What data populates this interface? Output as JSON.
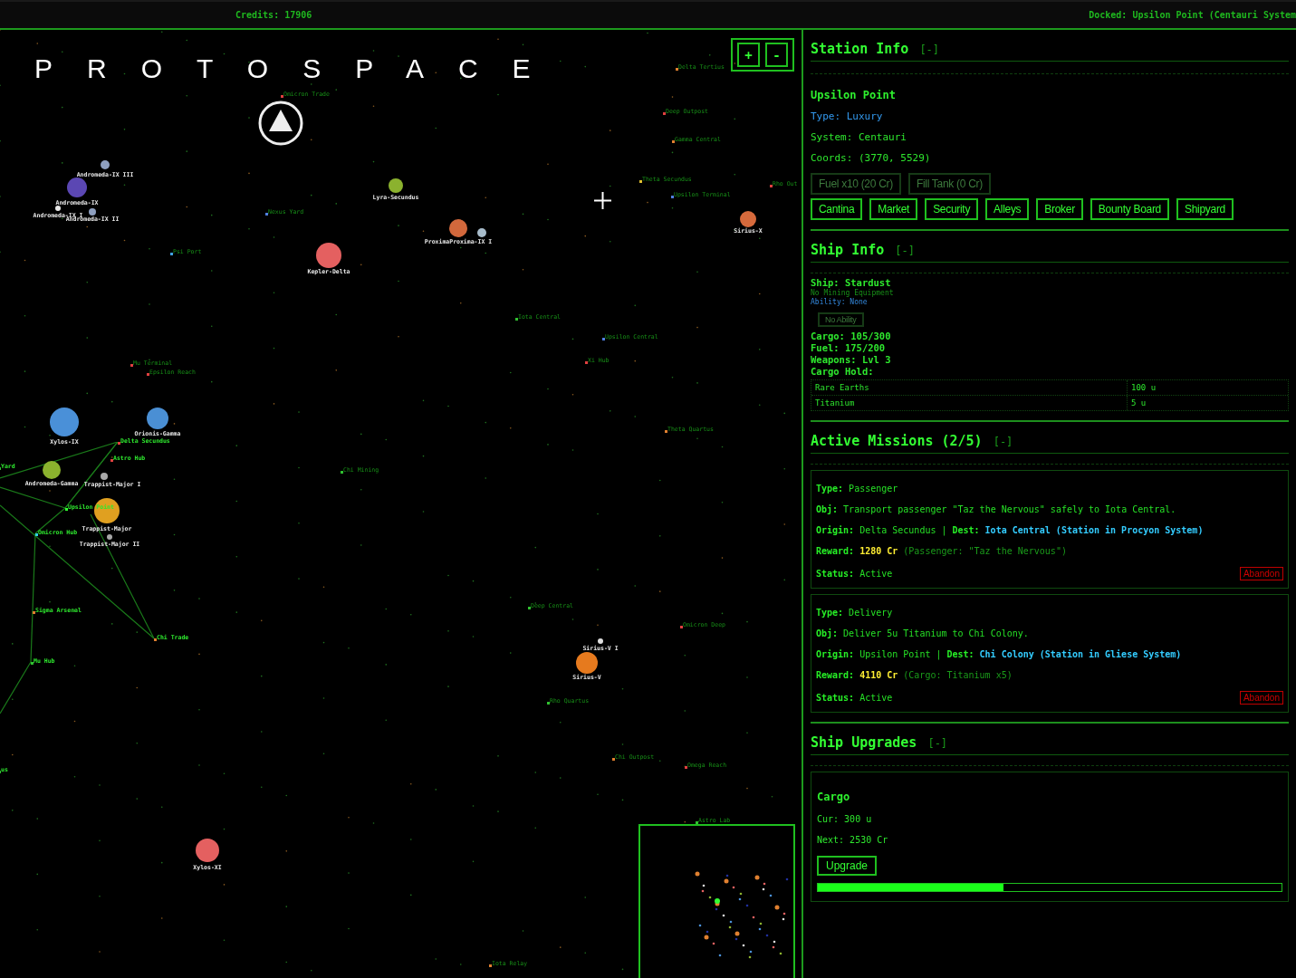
{
  "top_bar": {
    "credits": "Credits: 17906",
    "docked": "Docked: Upsilon Point (Centauri System"
  },
  "map": {
    "logo": "PROTOSPACE",
    "zoom_buttons": [
      "+",
      "-"
    ],
    "planets": [
      {
        "name": "Andromeda-IX III",
        "color": "#8e9fbf"
      },
      {
        "name": "Andromeda-IX",
        "color": "#5b47b3"
      },
      {
        "name": "Andromeda-IX I",
        "color": "#e8e8e8"
      },
      {
        "name": "Andromeda-IX II",
        "color": "#8e9fbf"
      },
      {
        "name": "Lyra-Secundus",
        "color": "#8bb22e"
      },
      {
        "name": "ProximaProxima-IX I",
        "color": "#d2683c"
      },
      {
        "color": "#a8bccb"
      },
      {
        "name": "Kepler-Delta",
        "color": "#e46060"
      },
      {
        "name": "Sirius-X",
        "color": "#d66a3c"
      },
      {
        "name": "Xylos-IX",
        "color": "#4a90d8"
      },
      {
        "name": "Orionis-Gamma",
        "color": "#4a8fd4"
      },
      {
        "name": "Andromeda-Gamma",
        "color": "#8bb22e"
      },
      {
        "name": "Trappist-Major I",
        "color": "#a8a8a8"
      },
      {
        "name": "Trappist-Major",
        "color": "#e0a020"
      },
      {
        "name": "Trappist-Major II",
        "color": "#a8a8a8"
      },
      {
        "name": "Sirius-V I",
        "color": "#dddddd"
      },
      {
        "name": "Sirius-V",
        "color": "#e67a1e"
      },
      {
        "name": "Xylos-XI",
        "color": "#e46060"
      }
    ],
    "stations": [
      {
        "name": "Delta Tertius",
        "color": "#e08030",
        "on_route": false
      },
      {
        "name": "Omicron Trade",
        "color": "#e04040",
        "on_route": false
      },
      {
        "name": "Deep Outpost",
        "color": "#e04040",
        "on_route": false
      },
      {
        "name": "Gamma Central",
        "color": "#e08030",
        "on_route": false
      },
      {
        "name": "Theta Secundus",
        "color": "#e0c030",
        "on_route": false
      },
      {
        "name": "Upsilon Terminal",
        "color": "#5080e0",
        "on_route": false
      },
      {
        "name": "Rho Out",
        "color": "#e04040",
        "on_route": false
      },
      {
        "name": "Nexus Yard",
        "color": "#5080e0",
        "on_route": false
      },
      {
        "name": "Psi Port",
        "color": "#40a0e0",
        "on_route": false
      },
      {
        "name": "Iota Central",
        "color": "#30c030",
        "on_route": false
      },
      {
        "name": "Upsilon Central",
        "color": "#5080e0",
        "on_route": false
      },
      {
        "name": "Xi Hub",
        "color": "#e04040",
        "on_route": false
      },
      {
        "name": "Mu Terminal",
        "color": "#e04040",
        "on_route": false
      },
      {
        "name": "Epsilon Reach",
        "color": "#e04040",
        "on_route": false
      },
      {
        "name": "Theta Quartus",
        "color": "#e08030",
        "on_route": false
      },
      {
        "name": "Chi Mining",
        "color": "#30c030",
        "on_route": false
      },
      {
        "name": "Delta Secundus",
        "color": "#e04040",
        "on_route": true
      },
      {
        "name": "Astro Hub",
        "color": "#e04040",
        "on_route": true
      },
      {
        "name": "Upsilon Point",
        "color": "#30ff30",
        "on_route": true
      },
      {
        "name": "Omicron Hub",
        "color": "#30d0e0",
        "on_route": true
      },
      {
        "name": "Yard",
        "color": "#30c030",
        "on_route": true
      },
      {
        "name": "Sigma Arsenal",
        "color": "#e08030",
        "on_route": true
      },
      {
        "name": "Chi Trade",
        "color": "#e08030",
        "on_route": true
      },
      {
        "name": "Mu Hub",
        "color": "#30c030",
        "on_route": true
      },
      {
        "name": "us",
        "color": "#30c030",
        "on_route": true
      },
      {
        "name": "Deep Central",
        "color": "#30c030",
        "on_route": false
      },
      {
        "name": "Omicron Deep",
        "color": "#e04040",
        "on_route": false
      },
      {
        "name": "Rho Quartus",
        "color": "#30c030",
        "on_route": false
      },
      {
        "name": "Chi Outpost",
        "color": "#e08030",
        "on_route": false
      },
      {
        "name": "Omega Reach",
        "color": "#e04040",
        "on_route": false
      },
      {
        "name": "Astro Lab",
        "color": "#30c030",
        "on_route": false
      },
      {
        "name": "Iota Relay",
        "color": "#e08030",
        "on_route": false
      }
    ]
  },
  "station_info": {
    "title": "Station Info",
    "toggle": "[-]",
    "name": "Upsilon Point",
    "details": [
      {
        "text": "Type: Luxury",
        "kind": "type"
      },
      {
        "text": "System: Centauri",
        "kind": "plain"
      },
      {
        "text": "Coords: (3770, 5529)",
        "kind": "plain"
      }
    ],
    "fuel_buttons": [
      {
        "label": "Fuel x10 (20 Cr)",
        "disabled": true
      },
      {
        "label": "Fill Tank (0 Cr)",
        "disabled": true
      }
    ],
    "nav_buttons": [
      "Cantina",
      "Market",
      "Security",
      "Alleys",
      "Broker",
      "Bounty Board",
      "Shipyard"
    ]
  },
  "ship_info": {
    "title": "Ship Info",
    "toggle": "[-]",
    "ship": "Ship: Stardust",
    "mining": "No Mining Equipment",
    "ability": "Ability: None",
    "ability_button": {
      "label": "No Ability",
      "disabled": true
    },
    "stats": [
      "Cargo: 105/300",
      "Fuel: 175/200",
      "Weapons: Lvl 3",
      "Cargo Hold:"
    ],
    "cargo_hold": [
      {
        "item": "Rare Earths",
        "amount": "100 u"
      },
      {
        "item": "Titanium",
        "amount": "5 u"
      }
    ]
  },
  "missions": {
    "title": "Active Missions (2/5)",
    "toggle": "[-]",
    "items": [
      {
        "lines": [
          [
            {
              "text": "Type:",
              "kind": "label"
            },
            {
              "text": "Passenger",
              "kind": "plain"
            }
          ],
          [
            {
              "text": "Obj:",
              "kind": "label"
            },
            {
              "text": "Transport passenger \"Taz the Nervous\" safely to Iota Central.",
              "kind": "plain"
            }
          ],
          [
            {
              "text": "Origin:",
              "kind": "label"
            },
            {
              "text": "Delta Secundus",
              "kind": "plain"
            },
            {
              "text": "|",
              "kind": "plain"
            },
            {
              "text": "Dest:",
              "kind": "label"
            },
            {
              "text": "Iota Central (Station in Procyon System)",
              "kind": "dest"
            }
          ],
          [
            {
              "text": "Reward:",
              "kind": "label"
            },
            {
              "text": "1280 Cr",
              "kind": "reward"
            },
            {
              "text": "(Passenger: \"Taz the Nervous\")",
              "kind": "note"
            }
          ]
        ],
        "status": [
          {
            "text": "Status:",
            "kind": "label"
          },
          {
            "text": "Active",
            "kind": "plain"
          }
        ],
        "action": "Abandon"
      },
      {
        "lines": [
          [
            {
              "text": "Type:",
              "kind": "label"
            },
            {
              "text": "Delivery",
              "kind": "plain"
            }
          ],
          [
            {
              "text": "Obj:",
              "kind": "label"
            },
            {
              "text": "Deliver 5u Titanium to Chi Colony.",
              "kind": "plain"
            }
          ],
          [
            {
              "text": "Origin:",
              "kind": "label"
            },
            {
              "text": "Upsilon Point",
              "kind": "plain"
            },
            {
              "text": "|",
              "kind": "plain"
            },
            {
              "text": "Dest:",
              "kind": "label"
            },
            {
              "text": "Chi Colony (Station in Gliese System)",
              "kind": "dest"
            }
          ],
          [
            {
              "text": "Reward:",
              "kind": "label"
            },
            {
              "text": "4110 Cr",
              "kind": "reward"
            },
            {
              "text": "(Cargo: Titanium x5)",
              "kind": "note"
            }
          ]
        ],
        "status": [
          {
            "text": "Status:",
            "kind": "label"
          },
          {
            "text": "Active",
            "kind": "plain"
          }
        ],
        "action": "Abandon"
      }
    ]
  },
  "upgrades": {
    "title": "Ship Upgrades",
    "toggle": "[-]",
    "items": [
      {
        "name": "Cargo",
        "current": "Cur: 300 u",
        "next": "Next: 2530 Cr",
        "button": "Upgrade",
        "level": 0.4
      }
    ]
  }
}
